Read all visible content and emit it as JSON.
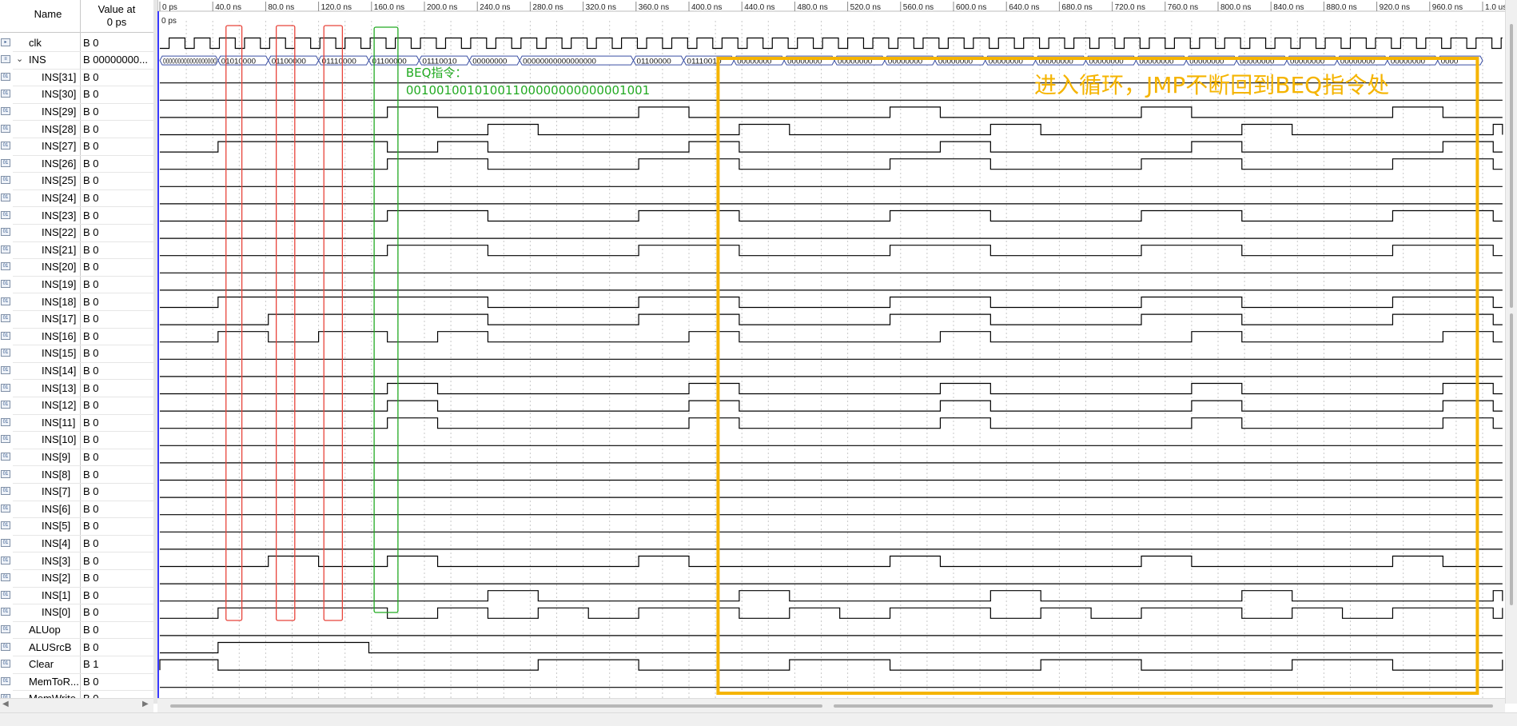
{
  "header": {
    "name_label": "Name",
    "value_label_line1": "Value at",
    "value_label_line2": "0 ps"
  },
  "time_axis": {
    "ticks": [
      "0 ps",
      "40.0 ns",
      "80.0 ns",
      "120.0 ns",
      "160.0 ns",
      "200.0 ns",
      "240.0 ns",
      "280.0 ns",
      "320.0 ns",
      "360.0 ns",
      "400.0 ns",
      "440.0 ns",
      "480.0 ns",
      "520.0 ns",
      "560.0 ns",
      "600.0 ns",
      "640.0 ns",
      "680.0 ns",
      "720.0 ns",
      "760.0 ns",
      "800.0 ns",
      "840.0 ns",
      "880.0 ns",
      "920.0 ns",
      "960.0 ns",
      "1.0 us"
    ],
    "cursor_label": "0 ps",
    "range_ns": [
      0,
      1000
    ]
  },
  "signals": [
    {
      "name": "clk",
      "value": "B 0",
      "icon": "input-pin-icon",
      "indent": false
    },
    {
      "name": "INS",
      "value": "B 00000000...",
      "icon": "bus-icon",
      "indent": false,
      "expandable": true
    },
    {
      "name": "INS[31]",
      "value": "B 0",
      "icon": "output-pin-icon",
      "indent": true
    },
    {
      "name": "INS[30]",
      "value": "B 0",
      "icon": "output-pin-icon",
      "indent": true
    },
    {
      "name": "INS[29]",
      "value": "B 0",
      "icon": "output-pin-icon",
      "indent": true
    },
    {
      "name": "INS[28]",
      "value": "B 0",
      "icon": "output-pin-icon",
      "indent": true
    },
    {
      "name": "INS[27]",
      "value": "B 0",
      "icon": "output-pin-icon",
      "indent": true
    },
    {
      "name": "INS[26]",
      "value": "B 0",
      "icon": "output-pin-icon",
      "indent": true
    },
    {
      "name": "INS[25]",
      "value": "B 0",
      "icon": "output-pin-icon",
      "indent": true
    },
    {
      "name": "INS[24]",
      "value": "B 0",
      "icon": "output-pin-icon",
      "indent": true
    },
    {
      "name": "INS[23]",
      "value": "B 0",
      "icon": "output-pin-icon",
      "indent": true
    },
    {
      "name": "INS[22]",
      "value": "B 0",
      "icon": "output-pin-icon",
      "indent": true
    },
    {
      "name": "INS[21]",
      "value": "B 0",
      "icon": "output-pin-icon",
      "indent": true
    },
    {
      "name": "INS[20]",
      "value": "B 0",
      "icon": "output-pin-icon",
      "indent": true
    },
    {
      "name": "INS[19]",
      "value": "B 0",
      "icon": "output-pin-icon",
      "indent": true
    },
    {
      "name": "INS[18]",
      "value": "B 0",
      "icon": "output-pin-icon",
      "indent": true
    },
    {
      "name": "INS[17]",
      "value": "B 0",
      "icon": "output-pin-icon",
      "indent": true
    },
    {
      "name": "INS[16]",
      "value": "B 0",
      "icon": "output-pin-icon",
      "indent": true
    },
    {
      "name": "INS[15]",
      "value": "B 0",
      "icon": "output-pin-icon",
      "indent": true
    },
    {
      "name": "INS[14]",
      "value": "B 0",
      "icon": "output-pin-icon",
      "indent": true
    },
    {
      "name": "INS[13]",
      "value": "B 0",
      "icon": "output-pin-icon",
      "indent": true
    },
    {
      "name": "INS[12]",
      "value": "B 0",
      "icon": "output-pin-icon",
      "indent": true
    },
    {
      "name": "INS[11]",
      "value": "B 0",
      "icon": "output-pin-icon",
      "indent": true
    },
    {
      "name": "INS[10]",
      "value": "B 0",
      "icon": "output-pin-icon",
      "indent": true
    },
    {
      "name": "INS[9]",
      "value": "B 0",
      "icon": "output-pin-icon",
      "indent": true
    },
    {
      "name": "INS[8]",
      "value": "B 0",
      "icon": "output-pin-icon",
      "indent": true
    },
    {
      "name": "INS[7]",
      "value": "B 0",
      "icon": "output-pin-icon",
      "indent": true
    },
    {
      "name": "INS[6]",
      "value": "B 0",
      "icon": "output-pin-icon",
      "indent": true
    },
    {
      "name": "INS[5]",
      "value": "B 0",
      "icon": "output-pin-icon",
      "indent": true
    },
    {
      "name": "INS[4]",
      "value": "B 0",
      "icon": "output-pin-icon",
      "indent": true
    },
    {
      "name": "INS[3]",
      "value": "B 0",
      "icon": "output-pin-icon",
      "indent": true
    },
    {
      "name": "INS[2]",
      "value": "B 0",
      "icon": "output-pin-icon",
      "indent": true
    },
    {
      "name": "INS[1]",
      "value": "B 0",
      "icon": "output-pin-icon",
      "indent": true
    },
    {
      "name": "INS[0]",
      "value": "B 0",
      "icon": "output-pin-icon",
      "indent": true
    },
    {
      "name": "ALUop",
      "value": "B 0",
      "icon": "output-pin-icon",
      "indent": false
    },
    {
      "name": "ALUSrcB",
      "value": "B 0",
      "icon": "output-pin-icon",
      "indent": false
    },
    {
      "name": "Clear",
      "value": "B 1",
      "icon": "output-pin-icon",
      "indent": false
    },
    {
      "name": "MemToR...",
      "value": "B 0",
      "icon": "output-pin-icon",
      "indent": false
    },
    {
      "name": "MemWrite",
      "value": "B 0",
      "icon": "output-pin-icon",
      "indent": false
    }
  ],
  "bus_values": [
    {
      "t0": 0,
      "t1": 44,
      "text": "000000000000000000"
    },
    {
      "t0": 44,
      "t1": 82,
      "text": "01010000"
    },
    {
      "t0": 82,
      "t1": 120,
      "text": "01100000"
    },
    {
      "t0": 120,
      "t1": 158,
      "text": "01110000"
    },
    {
      "t0": 158,
      "t1": 196,
      "text": "01100000"
    },
    {
      "t0": 196,
      "t1": 234,
      "text": "01110010"
    },
    {
      "t0": 234,
      "t1": 272,
      "text": "00000000"
    },
    {
      "t0": 272,
      "t1": 358,
      "text": "00000000000000000"
    },
    {
      "t0": 358,
      "t1": 396,
      "text": "01100000"
    },
    {
      "t0": 396,
      "t1": 434,
      "text": "01110010"
    },
    {
      "t0": 434,
      "t1": 472,
      "text": "00000000"
    },
    {
      "t0": 472,
      "t1": 510,
      "text": "00000000"
    },
    {
      "t0": 510,
      "t1": 548,
      "text": "00000000"
    },
    {
      "t0": 548,
      "t1": 586,
      "text": "00000000"
    },
    {
      "t0": 586,
      "t1": 624,
      "text": "00000000"
    },
    {
      "t0": 624,
      "t1": 662,
      "text": "00000000"
    },
    {
      "t0": 662,
      "t1": 700,
      "text": "00000000"
    },
    {
      "t0": 700,
      "t1": 738,
      "text": "00000000"
    },
    {
      "t0": 738,
      "t1": 776,
      "text": "00000000"
    },
    {
      "t0": 776,
      "t1": 814,
      "text": "00000000"
    },
    {
      "t0": 814,
      "t1": 852,
      "text": "00000000"
    },
    {
      "t0": 852,
      "t1": 890,
      "text": "00000000"
    },
    {
      "t0": 890,
      "t1": 928,
      "text": "00000000"
    },
    {
      "t0": 928,
      "t1": 966,
      "text": "00000000"
    },
    {
      "t0": 966,
      "t1": 1000,
      "text": "0000"
    }
  ],
  "waveforms": {
    "INS[29]": [
      [
        172,
        210
      ],
      [
        362,
        400
      ],
      [
        552,
        590
      ],
      [
        742,
        780
      ],
      [
        932,
        970
      ]
    ],
    "INS[28]": [
      [
        248,
        286
      ],
      [
        438,
        476
      ],
      [
        628,
        666
      ],
      [
        818,
        856
      ],
      [
        1008,
        1046
      ]
    ],
    "INS[27]": [
      [
        44,
        172
      ],
      [
        210,
        248
      ],
      [
        400,
        438
      ],
      [
        590,
        628
      ],
      [
        780,
        818
      ],
      [
        970,
        1008
      ]
    ],
    "INS[26]": [
      [
        172,
        248
      ],
      [
        362,
        438
      ],
      [
        552,
        628
      ],
      [
        742,
        818
      ],
      [
        932,
        1008
      ]
    ],
    "INS[23]": [
      [
        172,
        248
      ],
      [
        362,
        438
      ],
      [
        552,
        628
      ],
      [
        742,
        818
      ],
      [
        932,
        1008
      ]
    ],
    "INS[21]": [
      [
        172,
        248
      ],
      [
        362,
        438
      ],
      [
        552,
        628
      ],
      [
        742,
        818
      ],
      [
        932,
        1008
      ]
    ],
    "INS[18]": [
      [
        44,
        248
      ],
      [
        362,
        438
      ],
      [
        552,
        628
      ],
      [
        742,
        818
      ],
      [
        932,
        1008
      ]
    ],
    "INS[17]": [
      [
        82,
        248
      ],
      [
        362,
        438
      ],
      [
        552,
        628
      ],
      [
        742,
        818
      ],
      [
        932,
        1008
      ]
    ],
    "INS[16]": [
      [
        44,
        82
      ],
      [
        120,
        172
      ],
      [
        210,
        248
      ],
      [
        400,
        438
      ],
      [
        590,
        628
      ],
      [
        780,
        818
      ],
      [
        970,
        1008
      ]
    ],
    "INS[13]": [
      [
        172,
        210
      ],
      [
        400,
        438
      ],
      [
        590,
        628
      ],
      [
        780,
        818
      ],
      [
        970,
        1008
      ]
    ],
    "INS[12]": [
      [
        172,
        210
      ],
      [
        400,
        438
      ],
      [
        590,
        628
      ],
      [
        780,
        818
      ],
      [
        970,
        1008
      ]
    ],
    "INS[11]": [
      [
        172,
        210
      ],
      [
        400,
        438
      ],
      [
        590,
        628
      ],
      [
        780,
        818
      ],
      [
        970,
        1008
      ]
    ],
    "INS[3]": [
      [
        82,
        120
      ],
      [
        172,
        210
      ],
      [
        362,
        400
      ],
      [
        552,
        590
      ],
      [
        742,
        780
      ],
      [
        932,
        970
      ]
    ],
    "INS[1]": [
      [
        248,
        286
      ],
      [
        438,
        476
      ],
      [
        628,
        666
      ],
      [
        818,
        856
      ],
      [
        1008,
        1046
      ]
    ],
    "INS[0]": [
      [
        44,
        172
      ],
      [
        210,
        248
      ],
      [
        286,
        324
      ],
      [
        362,
        438
      ],
      [
        476,
        514
      ],
      [
        552,
        628
      ],
      [
        666,
        704
      ],
      [
        742,
        818
      ],
      [
        856,
        894
      ],
      [
        932,
        1008
      ],
      [
        1046,
        1084
      ]
    ],
    "ALUSrcB": [
      [
        44,
        158
      ]
    ],
    "Clear": [
      [
        0,
        44
      ],
      [
        286,
        362
      ],
      [
        476,
        552
      ],
      [
        666,
        742
      ],
      [
        856,
        932
      ],
      [
        1046,
        1084
      ]
    ]
  },
  "annotations": {
    "beq_label_line1": "BEQ指令：",
    "beq_label_line2": "00100100101001100000000000001001",
    "loop_note": "进入循环，JMP不断回到BEQ指令处",
    "red_color": "#e8443a",
    "green_color": "#22aa22",
    "orange_color": "#f5b400",
    "red_boxes_ns": [
      [
        50,
        62
      ],
      [
        88,
        102
      ],
      [
        124,
        138
      ]
    ],
    "green_box_ns": [
      162,
      180
    ],
    "orange_box_ns": [
      422,
      996
    ]
  },
  "colors": {
    "wave": "#000000",
    "grid": "#c9c9c9",
    "cursor": "#3a3aff",
    "bus_outline": "#3b4fa3"
  }
}
